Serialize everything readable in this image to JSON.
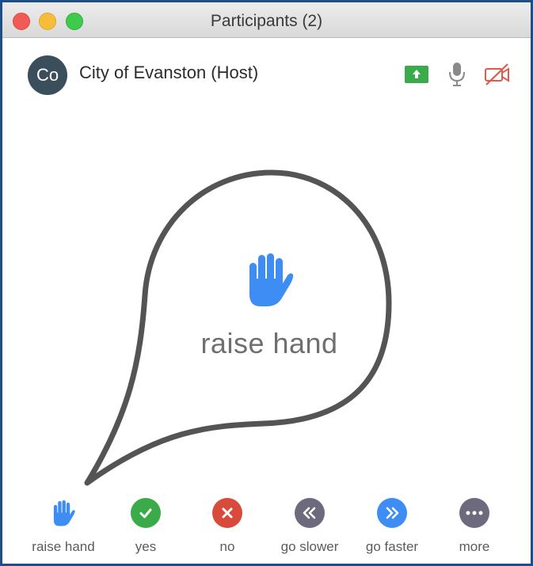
{
  "window": {
    "title": "Participants (2)"
  },
  "participant": {
    "initials": "Co",
    "name": "City of Evanston (Host)",
    "icons": [
      "screen-share-icon",
      "microphone-icon",
      "video-off-icon"
    ]
  },
  "callout": {
    "label": "raise hand",
    "icon": "raise-hand-icon"
  },
  "reactions": [
    {
      "label": "raise hand",
      "icon": "raise-hand-icon",
      "color": "#3d8df5"
    },
    {
      "label": "yes",
      "icon": "check-icon",
      "color": "#3bab4a"
    },
    {
      "label": "no",
      "icon": "x-icon",
      "color": "#d84a3c"
    },
    {
      "label": "go slower",
      "icon": "rewind-icon",
      "color": "#6d6a7d"
    },
    {
      "label": "go faster",
      "icon": "fast-forward-icon",
      "color": "#3d8df5"
    },
    {
      "label": "more",
      "icon": "more-icon",
      "color": "#6d6a7d"
    }
  ],
  "colors": {
    "window_border": "#1d4e89",
    "share_green": "#3aab4a",
    "video_off_red": "#e05a50",
    "callout_stroke": "#545454"
  }
}
